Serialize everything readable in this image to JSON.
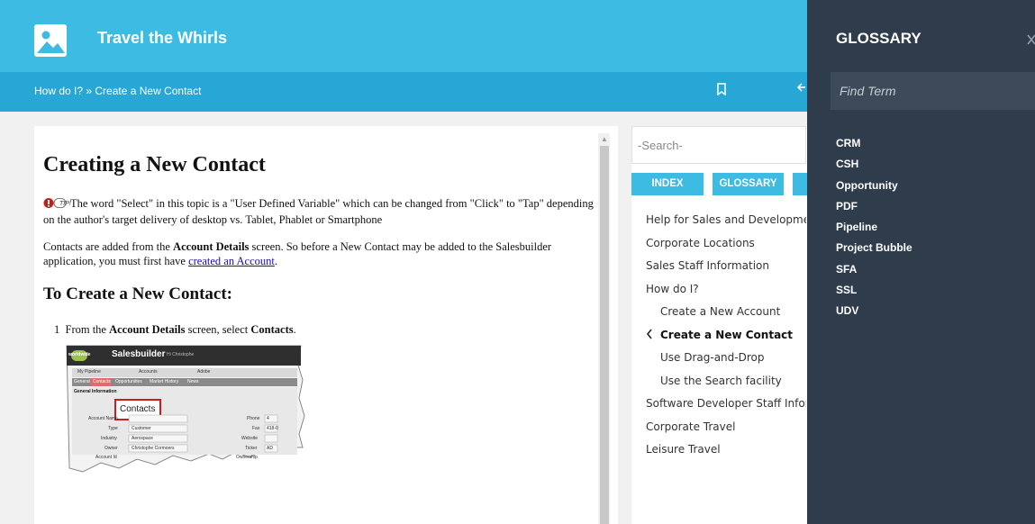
{
  "app": {
    "title": "Travel the Whirls"
  },
  "breadcrumb": {
    "text": "How do I? » Create a New Contact"
  },
  "content": {
    "title": "Creating a New Contact",
    "tip_label": "TIP!",
    "tip_text": "The word \"Select\" in this topic is a \"User Defined Variable\" which can be changed from \"Click\" to \"Tap\" depending on the author's target delivery of desktop vs. Tablet, Phablet or Smartphone",
    "para_before_bold": "Contacts are added from the ",
    "para_bold": "Account Details",
    "para_after_bold": " screen. So before a New Contact may be added to the Salesbuilder application, you must first have ",
    "para_link": "created an Account",
    "para_end": ".",
    "subtitle": "To Create a New Contact:",
    "step_number": "1",
    "step_before": "From the ",
    "step_bold1": "Account Details",
    "step_middle": " screen, select ",
    "step_bold2": "Contacts",
    "step_end": "."
  },
  "screenshot": {
    "app_name": "Salesbuilder",
    "brand": "worldwide",
    "user": "Hi Christophe",
    "tabs": [
      "My Pipeline",
      "Accounts",
      "Adobe"
    ],
    "subtabs": [
      "General",
      "Contacts",
      "Opportunities",
      "Market History",
      "News"
    ],
    "section": "General Information",
    "callout": "Contacts",
    "fields_left": [
      "Account Name",
      "Type",
      "Industry",
      "Owner",
      "Account Id"
    ],
    "values_left": [
      "",
      "Customer",
      "Aerospace",
      "Christophe Cormoers",
      ""
    ],
    "fields_right": [
      "Phone",
      "Fax",
      "Website",
      "Ticker",
      "Ownership"
    ],
    "values_right": [
      "4",
      "418-0",
      "",
      "AD",
      ""
    ]
  },
  "sidebar": {
    "search_placeholder": "-Search-",
    "tabs": [
      "INDEX",
      "GLOSSARY"
    ],
    "nav": [
      {
        "label": "Help for Sales and Development"
      },
      {
        "label": "Corporate Locations"
      },
      {
        "label": "Sales Staff Information"
      },
      {
        "label": "How do I?"
      },
      {
        "label": "Create a New Account"
      },
      {
        "label": "Create a New Contact"
      },
      {
        "label": "Use Drag-and-Drop"
      },
      {
        "label": "Use the Search facility"
      },
      {
        "label": "Software Developer Staff Information"
      },
      {
        "label": "Corporate Travel"
      },
      {
        "label": "Leisure Travel"
      }
    ]
  },
  "glossary": {
    "title": "GLOSSARY",
    "find_placeholder": "Find Term",
    "terms": [
      "CRM",
      "CSH",
      "Opportunity",
      "PDF",
      "Pipeline",
      "Project Bubble",
      "SFA",
      "SSL",
      "UDV"
    ]
  },
  "colors": {
    "header": "#3dbbe3",
    "breadbar": "#26a7d6",
    "glossary_bg": "#2f3c4c",
    "tab": "#3dbbe3"
  }
}
